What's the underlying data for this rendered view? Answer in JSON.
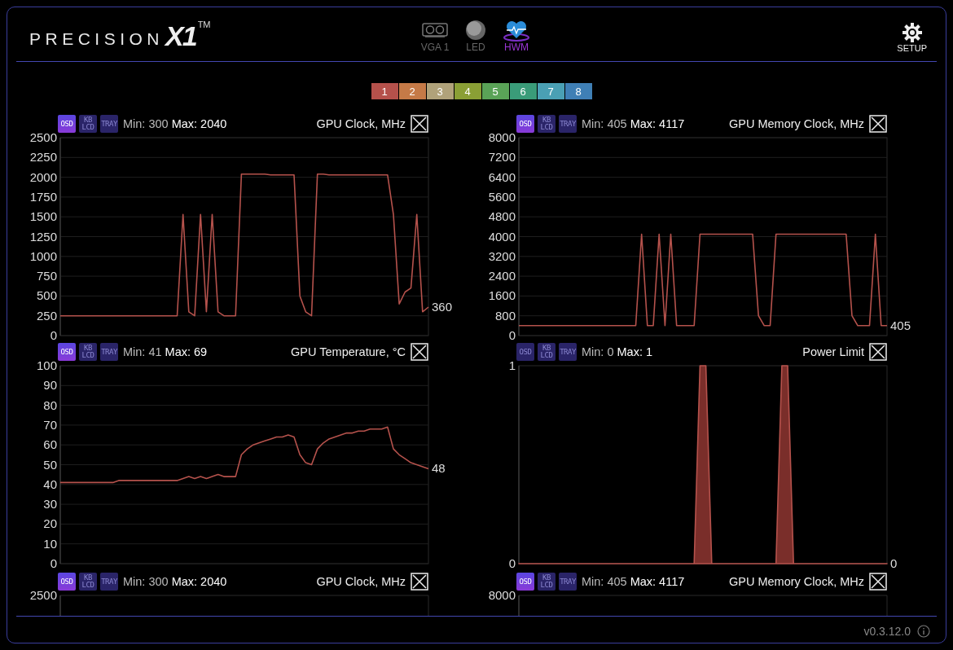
{
  "logo": {
    "word": "PRECISION",
    "mark": "X1",
    "tm": "TM"
  },
  "nav": [
    {
      "kind": "card",
      "label": "VGA 1",
      "selected": false
    },
    {
      "kind": "led",
      "label": "LED",
      "selected": false
    },
    {
      "kind": "heart",
      "label": "HWM",
      "selected": true
    }
  ],
  "setup": {
    "label": "SETUP"
  },
  "swatches": [
    {
      "label": "1",
      "color": "#b5514b"
    },
    {
      "label": "2",
      "color": "#c57a47"
    },
    {
      "label": "3",
      "color": "#b0a27a"
    },
    {
      "label": "4",
      "color": "#8a9f35"
    },
    {
      "label": "5",
      "color": "#5aa357"
    },
    {
      "label": "6",
      "color": "#3a9c79"
    },
    {
      "label": "7",
      "color": "#4aa0b4"
    },
    {
      "label": "8",
      "color": "#3f7fb5"
    }
  ],
  "panels": [
    {
      "kind": "full",
      "toggles": [
        {
          "label": "OSD",
          "on": true
        },
        {
          "label": "KB LCD",
          "on": false
        },
        {
          "label": "TRAY",
          "on": false
        }
      ],
      "min": "Min: 300",
      "max": "Max: 2040",
      "title": "GPU Clock, MHz",
      "current": "360",
      "chart_data": {
        "type": "line",
        "grid": true,
        "ylim": [
          0,
          2500
        ],
        "yticks": [
          0,
          250,
          500,
          750,
          1000,
          1250,
          1500,
          1750,
          2000,
          2250,
          2500
        ],
        "series": [
          {
            "color": "#b5524c",
            "values": [
              250,
              250,
              250,
              250,
              250,
              250,
              250,
              250,
              250,
              250,
              250,
              250,
              250,
              250,
              250,
              250,
              250,
              250,
              250,
              250,
              250,
              1530,
              300,
              250,
              1530,
              300,
              1530,
              300,
              250,
              250,
              250,
              2040,
              2040,
              2040,
              2040,
              2040,
              2030,
              2030,
              2030,
              2030,
              2030,
              500,
              300,
              250,
              2040,
              2040,
              2030,
              2030,
              2030,
              2030,
              2030,
              2030,
              2030,
              2030,
              2030,
              2030,
              2030,
              1530,
              400,
              550,
              600,
              1530,
              300,
              360
            ]
          }
        ]
      }
    },
    {
      "kind": "full",
      "toggles": [
        {
          "label": "OSD",
          "on": true
        },
        {
          "label": "KB LCD",
          "on": false
        },
        {
          "label": "TRAY",
          "on": false
        }
      ],
      "min": "Min: 405",
      "max": "Max: 4117",
      "title": "GPU Memory Clock, MHz",
      "current": "405",
      "chart_data": {
        "type": "line",
        "grid": true,
        "ylim": [
          0,
          8000
        ],
        "yticks": [
          0,
          800,
          1600,
          2400,
          3200,
          4000,
          4800,
          5600,
          6400,
          7200,
          8000
        ],
        "series": [
          {
            "color": "#b5524c",
            "values": [
              400,
              400,
              400,
              400,
              400,
              400,
              400,
              400,
              400,
              400,
              400,
              400,
              400,
              400,
              400,
              400,
              400,
              400,
              400,
              400,
              400,
              4100,
              400,
              400,
              4100,
              400,
              4100,
              400,
              400,
              400,
              400,
              4100,
              4100,
              4100,
              4100,
              4100,
              4100,
              4100,
              4100,
              4100,
              4100,
              800,
              400,
              400,
              4100,
              4100,
              4100,
              4100,
              4100,
              4100,
              4100,
              4100,
              4100,
              4100,
              4100,
              4100,
              4100,
              800,
              400,
              400,
              400,
              4100,
              400,
              400
            ]
          }
        ]
      }
    },
    {
      "kind": "full",
      "toggles": [
        {
          "label": "OSD",
          "on": true
        },
        {
          "label": "KB LCD",
          "on": false
        },
        {
          "label": "TRAY",
          "on": false
        }
      ],
      "min": "Min: 41",
      "max": "Max: 69",
      "title": "GPU Temperature, °C",
      "current": "48",
      "chart_data": {
        "type": "line",
        "grid": true,
        "ylim": [
          0,
          100
        ],
        "yticks": [
          0,
          10,
          20,
          30,
          40,
          50,
          60,
          70,
          80,
          90,
          100
        ],
        "series": [
          {
            "color": "#b5524c",
            "values": [
              41,
              41,
              41,
              41,
              41,
              41,
              41,
              41,
              41,
              41,
              42,
              42,
              42,
              42,
              42,
              42,
              42,
              42,
              42,
              42,
              42,
              43,
              44,
              43,
              44,
              43,
              44,
              45,
              44,
              44,
              44,
              55,
              58,
              60,
              61,
              62,
              63,
              64,
              64,
              65,
              64,
              55,
              51,
              50,
              58,
              61,
              63,
              64,
              65,
              66,
              66,
              67,
              67,
              68,
              68,
              68,
              69,
              58,
              55,
              53,
              51,
              50,
              49,
              48
            ]
          }
        ]
      }
    },
    {
      "kind": "full",
      "toggles": [
        {
          "label": "OSD",
          "on": false
        },
        {
          "label": "KB LCD",
          "on": false
        },
        {
          "label": "TRAY",
          "on": false
        }
      ],
      "min": "Min: 0",
      "max": "Max: 1",
      "title": "Power Limit",
      "current": "0",
      "chart_data": {
        "type": "area",
        "grid": false,
        "ylim": [
          0,
          1
        ],
        "yticks": [
          0,
          1
        ],
        "series": [
          {
            "color": "#b5524c",
            "values": [
              0,
              0,
              0,
              0,
              0,
              0,
              0,
              0,
              0,
              0,
              0,
              0,
              0,
              0,
              0,
              0,
              0,
              0,
              0,
              0,
              0,
              0,
              0,
              0,
              0,
              0,
              0,
              0,
              0,
              0,
              0,
              1,
              1,
              0,
              0,
              0,
              0,
              0,
              0,
              0,
              0,
              0,
              0,
              0,
              0,
              1,
              1,
              0,
              0,
              0,
              0,
              0,
              0,
              0,
              0,
              0,
              0,
              0,
              0,
              0,
              0,
              0,
              0,
              0
            ]
          }
        ]
      }
    },
    {
      "kind": "partial",
      "toggles": [
        {
          "label": "OSD",
          "on": true
        },
        {
          "label": "KB LCD",
          "on": false
        },
        {
          "label": "TRAY",
          "on": false
        }
      ],
      "min": "Min: 300",
      "max": "Max: 2040",
      "title": "GPU Clock, MHz",
      "top_tick": "2500"
    },
    {
      "kind": "partial",
      "toggles": [
        {
          "label": "OSD",
          "on": true
        },
        {
          "label": "KB LCD",
          "on": false
        },
        {
          "label": "TRAY",
          "on": false
        }
      ],
      "min": "Min: 405",
      "max": "Max: 4117",
      "title": "GPU Memory Clock, MHz",
      "top_tick": "8000"
    }
  ],
  "footer": {
    "version": "v0.3.12.0"
  }
}
